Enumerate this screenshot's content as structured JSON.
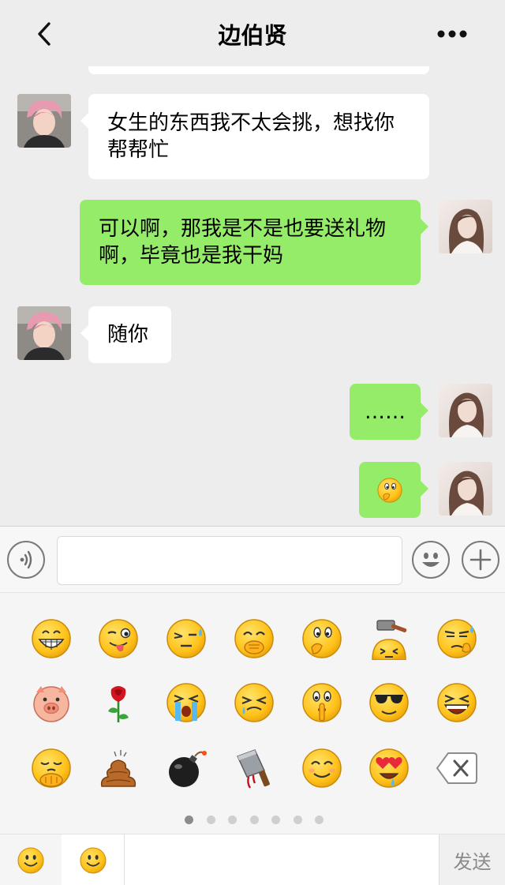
{
  "header": {
    "title": "边伯贤"
  },
  "messages": [
    {
      "side": "in",
      "text": "女生的东西我不太会挑，想找你帮帮忙"
    },
    {
      "side": "out",
      "text": "可以啊，那我是不是也要送礼物啊，毕竟也是我干妈"
    },
    {
      "side": "in",
      "text": "随你"
    },
    {
      "side": "out",
      "text": "……"
    },
    {
      "side": "out",
      "emoji": "cover-mouth-emoji"
    }
  ],
  "input": {
    "value": "",
    "placeholder": ""
  },
  "emoji_panel": {
    "rows": [
      [
        "grin",
        "tongue-wink",
        "sweat-awkward",
        "cover-mouth-laugh",
        "cover-mouth",
        "hammer-hit",
        "sweat-pick-nose"
      ],
      [
        "pig",
        "rose",
        "loud-cry",
        "smirk-tear",
        "shh-quiet",
        "cool-sunglasses",
        "laugh-out-loud"
      ],
      [
        "fist-greet",
        "poop",
        "bomb",
        "cleaver",
        "silly-smile",
        "heart-eyes",
        "backspace"
      ]
    ],
    "page_count": 7,
    "active_page": 1
  },
  "bottom": {
    "send_label": "发送"
  },
  "colors": {
    "background": "#ededed",
    "outgoing_bubble": "#95ec69",
    "incoming_bubble": "#ffffff",
    "emoji_yellow": "#ffc71f"
  }
}
